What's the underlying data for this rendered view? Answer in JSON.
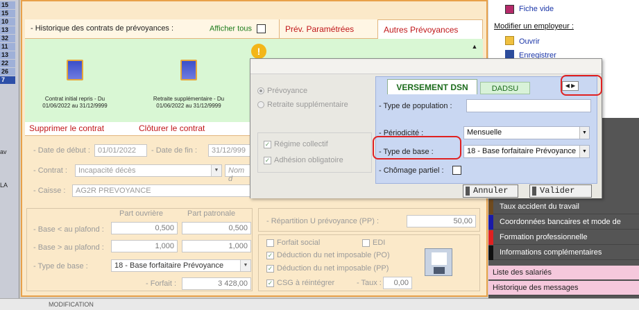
{
  "left_sidebar": {
    "row_numbers": [
      "15",
      "15",
      "10",
      "13",
      "32",
      "11",
      "13",
      "22",
      "26"
    ],
    "highlight": "7",
    "side_labels": [
      "av",
      "LA"
    ]
  },
  "history": {
    "title": "- Historique des contrats de prévoyances :",
    "show_all": "Afficher tous",
    "tab_parametered": "Prév. Paramétrées",
    "tab_other": "Autres Prévoyances",
    "contracts": [
      {
        "label": "Contrat initial repris - Du 01/06/2022 au 31/12/9999"
      },
      {
        "label": "Retraite supplémentaire - Du 01/06/2022 au 31/12/9999"
      }
    ],
    "warning_icon": "!"
  },
  "actions": {
    "delete": "Supprimer le contrat",
    "close": "Clôturer le contrat"
  },
  "form": {
    "start_label": "- Date de début :",
    "start_value": "01/01/2022",
    "end_label": "- Date de fin :",
    "end_value": "31/12/999",
    "contract_label": "- Contrat :",
    "contract_value": "Incapacité décès",
    "name_placeholder": "Nom d",
    "caisse_label": "- Caisse :",
    "caisse_value": "AG2R PREVOYANCE",
    "part_ouvriere": "Part ouvrière",
    "part_patronale": "Part patronale",
    "base_lt_label": "- Base < au plafond :",
    "base_lt_ouv": "0,500",
    "base_lt_pat": "0,500",
    "base_gt_label": "- Base > au plafond :",
    "base_gt_ouv": "1,000",
    "base_gt_pat": "1,000",
    "type_base_label": "- Type de base :",
    "type_base_value": "18 - Base forfaitaire Prévoyance",
    "forfait_label": "- Forfait :",
    "forfait_value": "3 428,00",
    "repartition_label": "- Répartition U prévoyance (PP) :",
    "repartition_value": "50,00",
    "forfait_social": "Forfait social",
    "edi": "EDI",
    "deduction_po": "Déduction du net imposable (PO)",
    "deduction_pp": "Déduction du net imposable (PP)",
    "csg": "CSG à réintégrer",
    "taux_label": "- Taux :",
    "taux_value": "0,00"
  },
  "right_panel": {
    "fiche_vide": "Fiche vide",
    "modifier": "Modifier un employeur :",
    "ouvrir": "Ouvrir",
    "enregistrer": "Enregistrer",
    "menu": [
      {
        "label": "Taux accident du travail",
        "color": "#6e4a1f"
      },
      {
        "label": "Coordonnées bancaires et mode de",
        "color": "#1a1aa8"
      },
      {
        "label": "Formation professionnelle",
        "color": "#e02020"
      },
      {
        "label": "Informations complémentaires",
        "color": "#111111"
      },
      {
        "label": "Liste des salariés",
        "color": ""
      },
      {
        "label": "Historique des messages",
        "color": ""
      }
    ]
  },
  "dialog": {
    "radio_prevoyance": "Prévoyance",
    "radio_retraite": "Retraite supplémentaire",
    "regime_collectif": "Régime collectif",
    "adhesion": "Adhésion obligatoire",
    "tab_dsn": "VERSEMENT DSN",
    "tab_dadsu": "DADSU",
    "type_population_label": "- Type de population :",
    "type_population_value": "",
    "periodicite_label": "- Périodicité :",
    "periodicite_value": "Mensuelle",
    "type_base_label": "- Type de base :",
    "type_base_value": "18 - Base forfaitaire Prévoyance",
    "chomage_label": "- Chômage partiel :",
    "cancel": "Annuler",
    "validate": "Valider"
  },
  "bottom": {
    "text": "MODIFICATION"
  },
  "colors": {
    "accent_red": "#c0171a",
    "frame_orange": "#e8a14a",
    "callout_red": "#e02020"
  }
}
